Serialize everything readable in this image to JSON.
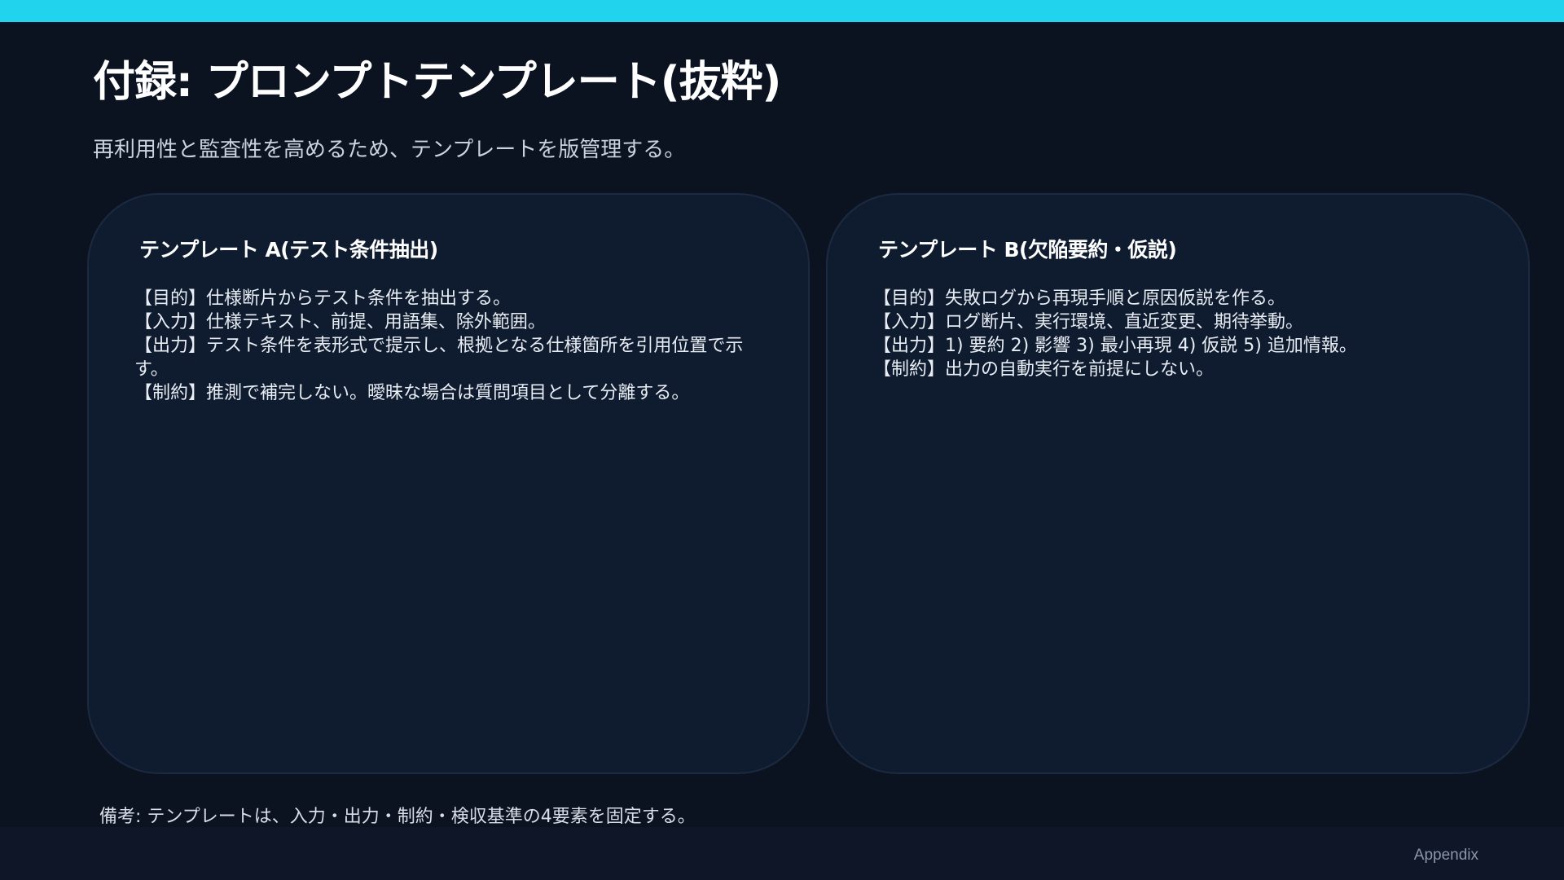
{
  "slide": {
    "title": "付録: プロンプトテンプレート(抜粋)",
    "subtitle": "再利用性と監査性を高めるため、テンプレートを版管理する。",
    "accent_color": "#22d3ee",
    "background_color": "#0b1220",
    "card_color": "#0f1c30"
  },
  "cards": [
    {
      "title": "テンプレート A(テスト条件抽出)",
      "lines": [
        "【目的】仕様断片からテスト条件を抽出する。",
        "【入力】仕様テキスト、前提、用語集、除外範囲。",
        "【出力】テスト条件を表形式で提示し、根拠となる仕様箇所を引用位置で示す。",
        "【制約】推測で補完しない。曖昧な場合は質問項目として分離する。"
      ]
    },
    {
      "title": "テンプレート B(欠陥要約・仮説)",
      "lines": [
        "【目的】失敗ログから再現手順と原因仮説を作る。",
        "【入力】ログ断片、実行環境、直近変更、期待挙動。",
        "【出力】1) 要約 2) 影響 3) 最小再現 4) 仮説 5) 追加情報。",
        "【制約】出力の自動実行を前提にしない。"
      ]
    }
  ],
  "note": "備考: テンプレートは、入力・出力・制約・検収基準の4要素を固定する。",
  "footer": {
    "label": "Appendix"
  }
}
